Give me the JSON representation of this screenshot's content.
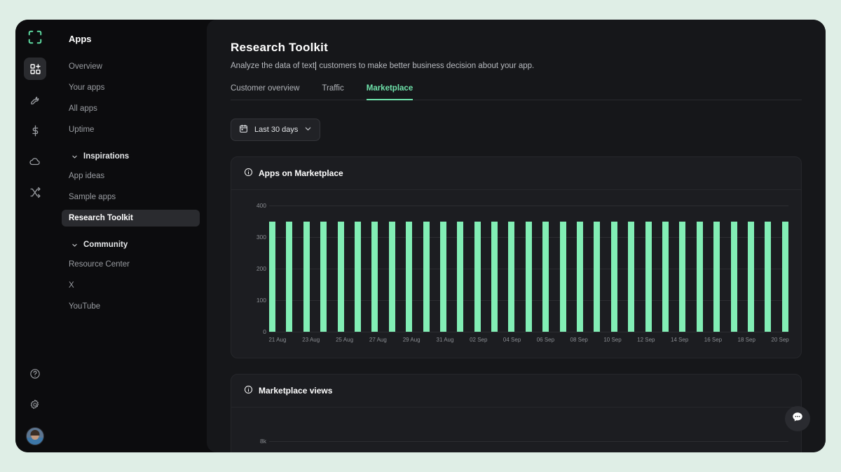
{
  "rail": {
    "logo_icon": "brand-logo-icon",
    "items": [
      {
        "icon": "apps-grid-plus-icon",
        "active": true
      },
      {
        "icon": "wrench-icon",
        "active": false
      },
      {
        "icon": "dollar-icon",
        "active": false
      },
      {
        "icon": "cloud-icon",
        "active": false
      },
      {
        "icon": "shuffle-icon",
        "active": false
      }
    ],
    "bottom": [
      {
        "icon": "help-circle-icon"
      },
      {
        "icon": "gear-icon"
      }
    ],
    "avatar_label": "user-avatar"
  },
  "sidebar": {
    "title": "Apps",
    "items": [
      {
        "label": "Overview",
        "active": false
      },
      {
        "label": "Your apps",
        "active": false
      },
      {
        "label": "All apps",
        "active": false
      },
      {
        "label": "Uptime",
        "active": false
      }
    ],
    "groups": [
      {
        "label": "Inspirations",
        "items": [
          {
            "label": "App ideas",
            "active": false
          },
          {
            "label": "Sample apps",
            "active": false
          },
          {
            "label": "Research Toolkit",
            "active": true
          }
        ]
      },
      {
        "label": "Community",
        "items": [
          {
            "label": "Resource Center",
            "active": false
          },
          {
            "label": "X",
            "active": false
          },
          {
            "label": "YouTube",
            "active": false
          }
        ]
      }
    ]
  },
  "header": {
    "title": "Research Toolkit",
    "subtitle_before": "Analyze the data of text",
    "subtitle_after": " customers to make better business decision about your app.",
    "tabs": [
      {
        "label": "Customer overview",
        "active": false
      },
      {
        "label": "Traffic",
        "active": false
      },
      {
        "label": "Marketplace",
        "active": true
      }
    ]
  },
  "filters": {
    "date_range_label": "Last 30 days",
    "calendar_icon": "calendar-icon",
    "chevron_icon": "chevron-down-icon"
  },
  "cards": [
    {
      "title": "Apps on Marketplace",
      "info_icon": "info-circle-icon"
    },
    {
      "title": "Marketplace views",
      "info_icon": "info-circle-icon"
    }
  ],
  "colors": {
    "accent": "#6fe3ab",
    "bar": "#82eeb5",
    "page_bg": "#dfeee6",
    "window_bg": "#0c0c0e",
    "panel_bg": "#16171a",
    "card_bg": "#1c1d21"
  },
  "fab": {
    "icon": "chat-bubble-icon"
  },
  "chart_data": [
    {
      "type": "bar",
      "title": "Apps on Marketplace",
      "xlabel": "",
      "ylabel": "",
      "ylim": [
        0,
        400
      ],
      "yticks": [
        0,
        100,
        200,
        300,
        400
      ],
      "ytick_labels": [
        "0",
        "100",
        "200",
        "300",
        "400"
      ],
      "grid": true,
      "legend": null,
      "categories": [
        "21 Aug",
        "22 Aug",
        "23 Aug",
        "24 Aug",
        "25 Aug",
        "26 Aug",
        "27 Aug",
        "28 Aug",
        "29 Aug",
        "30 Aug",
        "31 Aug",
        "01 Sep",
        "02 Sep",
        "03 Sep",
        "04 Sep",
        "05 Sep",
        "06 Sep",
        "07 Sep",
        "08 Sep",
        "09 Sep",
        "10 Sep",
        "11 Sep",
        "12 Sep",
        "13 Sep",
        "14 Sep",
        "15 Sep",
        "16 Sep",
        "17 Sep",
        "18 Sep",
        "19 Sep",
        "20 Sep"
      ],
      "visible_tick_labels": [
        "21 Aug",
        "23 Aug",
        "25 Aug",
        "27 Aug",
        "29 Aug",
        "31 Aug",
        "02 Sep",
        "04 Sep",
        "06 Sep",
        "08 Sep",
        "10 Sep",
        "12 Sep",
        "14 Sep",
        "16 Sep",
        "18 Sep",
        "20 Sep"
      ],
      "values": [
        350,
        350,
        350,
        350,
        350,
        350,
        350,
        350,
        350,
        350,
        350,
        350,
        350,
        350,
        350,
        350,
        350,
        350,
        350,
        350,
        350,
        350,
        350,
        350,
        350,
        350,
        350,
        350,
        350,
        350,
        350
      ]
    },
    {
      "type": "line",
      "title": "Marketplace views",
      "xlabel": "",
      "ylabel": "",
      "yticks": [
        8000
      ],
      "ytick_labels": [
        "8k"
      ],
      "grid": true,
      "categories": [],
      "values": []
    }
  ]
}
